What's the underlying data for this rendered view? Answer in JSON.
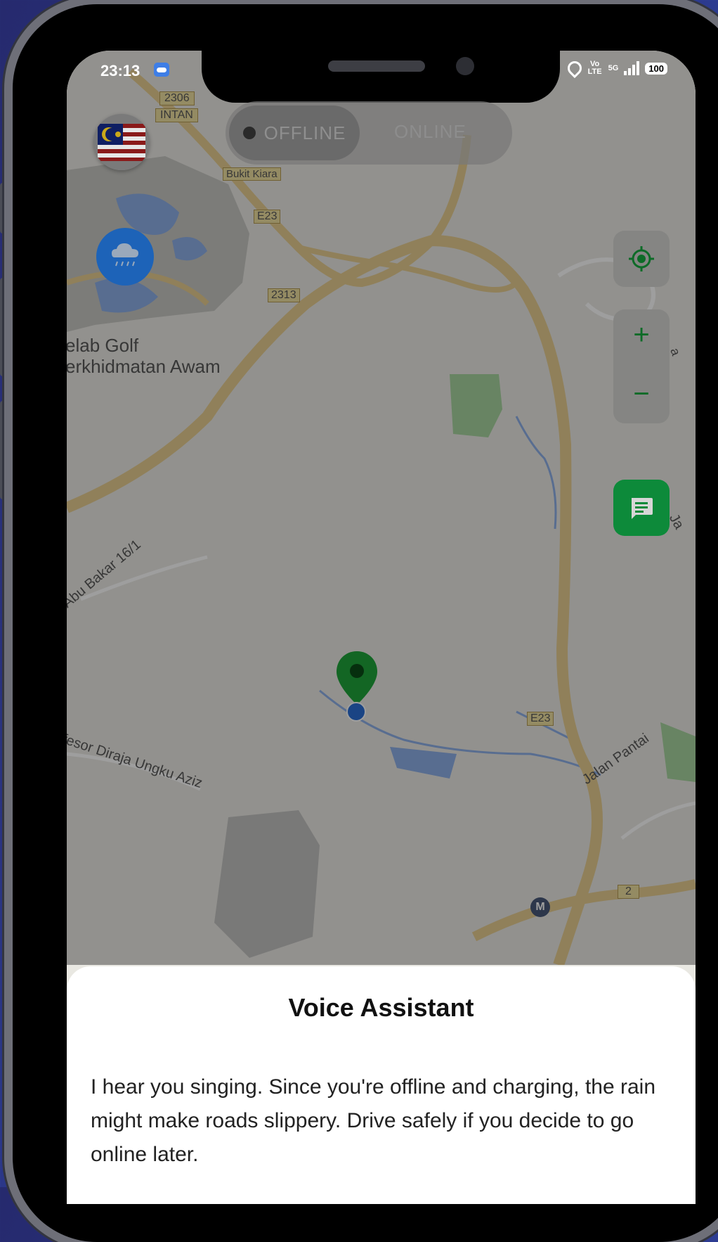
{
  "status_bar": {
    "time": "23:13",
    "network_label": "Vo LTE",
    "signal_label": "5G",
    "battery_level": "100"
  },
  "toggle": {
    "offline_label": "OFFLINE",
    "online_label": "ONLINE",
    "selected": "offline"
  },
  "map": {
    "road_badges": [
      "2306",
      "INTAN",
      "Bukit Kiara",
      "E23",
      "2313",
      "E23",
      "2"
    ],
    "place_labels": [
      "elab Golf",
      "erkhidmatan Awam",
      "Abu Bakar 16/1",
      "fesor Diraja Ungku Aziz",
      "Jalan Pantai",
      "Ja",
      "a"
    ],
    "metro_badge": "M"
  },
  "controls": {
    "zoom_in": "+",
    "zoom_out": "−",
    "icons": [
      "malaysia-flag-icon",
      "rain-cloud-icon",
      "locate-icon",
      "chat-icon",
      "map-pin-icon"
    ]
  },
  "colors": {
    "accent_green": "#0d8a3a",
    "weather_blue": "#1d63b8",
    "location_dot": "#2a6fd6"
  },
  "sheet": {
    "title": "Voice Assistant",
    "message": "I hear you singing.  Since you're offline and charging, the rain might make roads slippery. Drive safely if you decide to go online later."
  }
}
